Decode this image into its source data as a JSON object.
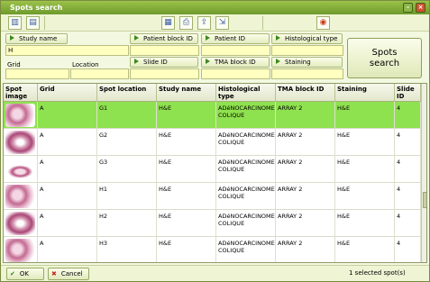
{
  "window": {
    "title": "Spots search"
  },
  "titlebar_buttons": {
    "minimize": "–",
    "close": "×"
  },
  "toolbar": {
    "icons": [
      "grid-view-icon",
      "detail-view-icon",
      "document-icon",
      "print-icon",
      "export-icon",
      "fit-icon",
      "settings-icon"
    ]
  },
  "filters": {
    "study_name": {
      "label": "Study name",
      "value": "H"
    },
    "patient_block_id": {
      "label": "Patient block ID",
      "value": ""
    },
    "patient_id": {
      "label": "Patient ID",
      "value": ""
    },
    "histological_type": {
      "label": "Histological type",
      "value": ""
    },
    "grid": {
      "label": "Grid",
      "value": ""
    },
    "location": {
      "label": "Location",
      "value": ""
    },
    "slide_id": {
      "label": "Slide ID",
      "value": ""
    },
    "tma_block_id": {
      "label": "TMA block ID",
      "value": ""
    },
    "staining": {
      "label": "Staining",
      "value": ""
    },
    "search_button": {
      "line1": "Spots",
      "line2": "search"
    }
  },
  "table": {
    "columns": [
      "Spot image",
      "Grid",
      "Spot location",
      "Study name",
      "Histological type",
      "TMA block ID",
      "Staining",
      "Slide ID"
    ],
    "rows": [
      {
        "grid": "A",
        "location": "G1",
        "study": "H&E",
        "histo1": "ADéNOCARCINOME",
        "histo2": "COLIQUE",
        "tma": "ARRAY 2",
        "stain": "H&E",
        "slide": "4",
        "selected": true
      },
      {
        "grid": "A",
        "location": "G2",
        "study": "H&E",
        "histo1": "ADéNOCARCINOME",
        "histo2": "COLIQUE",
        "tma": "ARRAY 2",
        "stain": "H&E",
        "slide": "4",
        "selected": false
      },
      {
        "grid": "A",
        "location": "G3",
        "study": "H&E",
        "histo1": "ADéNOCARCINOME",
        "histo2": "COLIQUE",
        "tma": "ARRAY 2",
        "stain": "H&E",
        "slide": "4",
        "selected": false
      },
      {
        "grid": "A",
        "location": "H1",
        "study": "H&E",
        "histo1": "ADéNOCARCINOME",
        "histo2": "COLIQUE",
        "tma": "ARRAY 2",
        "stain": "H&E",
        "slide": "4",
        "selected": false
      },
      {
        "grid": "A",
        "location": "H2",
        "study": "H&E",
        "histo1": "ADéNOCARCINOME",
        "histo2": "COLIQUE",
        "tma": "ARRAY 2",
        "stain": "H&E",
        "slide": "4",
        "selected": false
      },
      {
        "grid": "A",
        "location": "H3",
        "study": "H&E",
        "histo1": "ADéNOCARCINOME",
        "histo2": "COLIQUE",
        "tma": "ARRAY 2",
        "stain": "H&E",
        "slide": "4",
        "selected": false
      }
    ]
  },
  "footer": {
    "ok_label": "OK",
    "cancel_label": "Cancel",
    "status": "1 selected spot(s)"
  },
  "colors": {
    "selected_row": "#8fe24f",
    "titlebar": "#7aa836",
    "input_bg": "#ffffc0"
  }
}
